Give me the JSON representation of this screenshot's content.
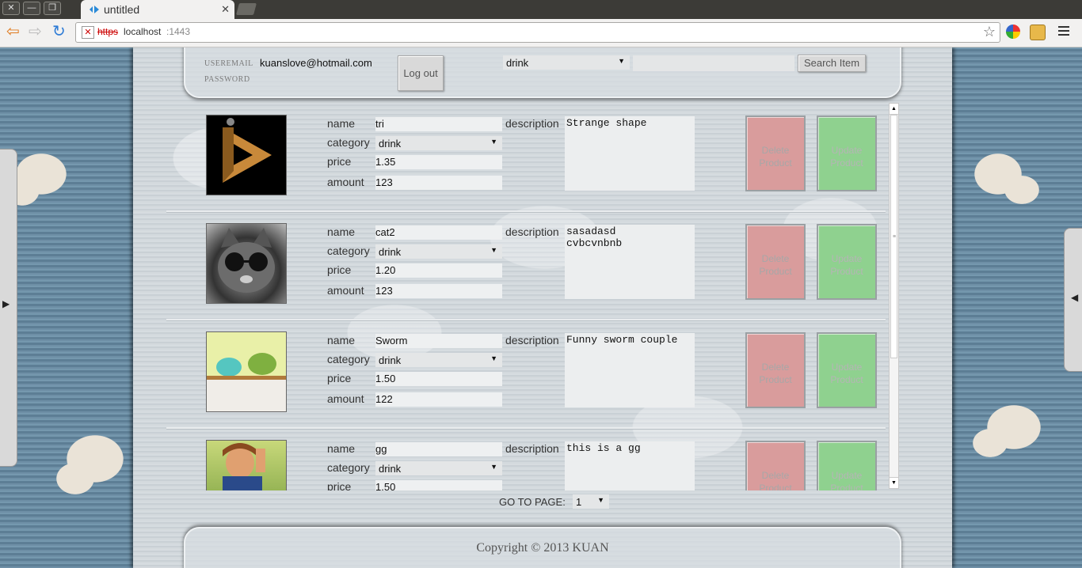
{
  "browser": {
    "tab_title": "untitled",
    "tab_close": "✕",
    "url_protocol": "https",
    "url_host": "localhost",
    "url_port": ":1443",
    "window_close": "✕",
    "window_min": "—",
    "window_max": "❐",
    "back": "⇦",
    "forward": "⇨",
    "reload": "↻",
    "bookmark": "☆"
  },
  "header": {
    "useremail_label": "USEREMAIL",
    "password_label": "PASSWORD",
    "useremail_value": "kuanslove@hotmail.com",
    "logout_label": "Log out",
    "category_filter": "drink",
    "search_value": "",
    "search_button": "Search Item"
  },
  "labels": {
    "name": "name",
    "category": "category",
    "price": "price",
    "amount": "amount",
    "description": "description",
    "delete_line1": "Delete",
    "delete_line2": "Product",
    "update_line1": "Update",
    "update_line2": "Product",
    "dropdown_arrow": "▼"
  },
  "products": [
    {
      "name": "tri",
      "category": "drink",
      "price": "1.35",
      "amount": "123",
      "description": "Strange shape",
      "image": "impossible-triangle"
    },
    {
      "name": "cat2",
      "category": "drink",
      "price": "1.20",
      "amount": "123",
      "description": "sasadasd\ncvbcvnbnb",
      "image": "cat-sunglasses"
    },
    {
      "name": "Sworm",
      "category": "drink",
      "price": "1.50",
      "amount": "122",
      "description": "Funny sworm couple",
      "image": "dinosaur-couple"
    },
    {
      "name": "gg",
      "category": "drink",
      "price": "1.50",
      "amount": "",
      "description": "this is a gg",
      "image": "girl-photo"
    }
  ],
  "pager": {
    "label": "GO TO PAGE:",
    "value": "1"
  },
  "footer": {
    "copyright": "Copyright © 2013 KUAN"
  },
  "sidepanels": {
    "left_arrow": "▶",
    "right_arrow": "◀"
  },
  "colors": {
    "delete_button": "#d99c9c",
    "update_button": "#8fd18f"
  }
}
